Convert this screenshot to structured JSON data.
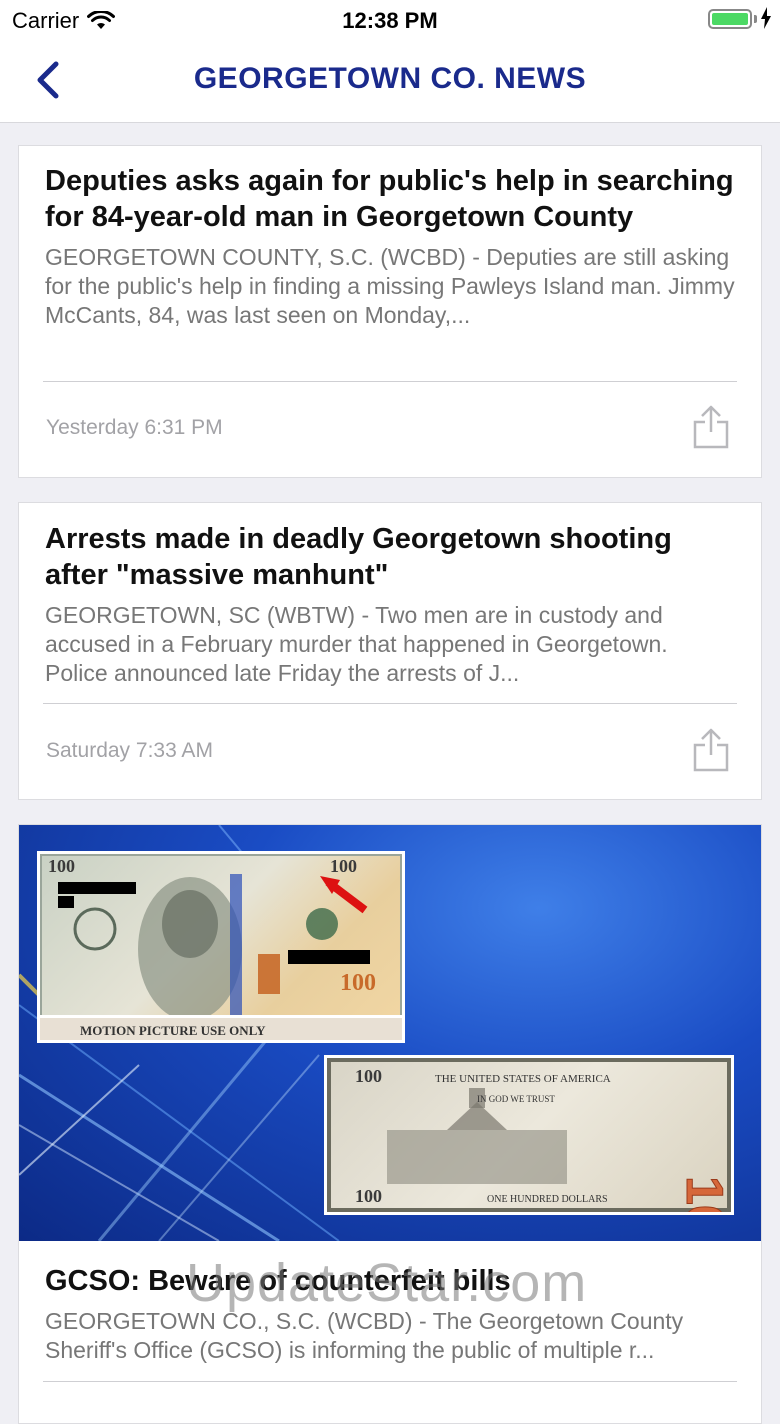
{
  "status_bar": {
    "carrier": "Carrier",
    "time": "12:38 PM",
    "battery_color": "#4cd964"
  },
  "nav": {
    "title": "GEORGETOWN CO. NEWS",
    "back_icon": "chevron-left-icon",
    "title_color": "#1a2a8c"
  },
  "articles": [
    {
      "title": "Deputies asks again for public's help in searching for 84-year-old man in Georgetown County",
      "summary": "GEORGETOWN COUNTY, S.C. (WCBD) - Deputies are still asking for the public's help in finding a missing Pawleys Island man. Jimmy McCants, 84, was last seen on Monday,...",
      "time": "Yesterday 6:31 PM",
      "share_icon": "share-icon"
    },
    {
      "title": "Arrests made in deadly Georgetown shooting after \"massive manhunt\"",
      "summary": "GEORGETOWN, SC (WBTW) - Two men are in custody and accused in a February murder that happened in Georgetown. Police announced late Friday the arrests of J...",
      "time": "Saturday 7:33 AM",
      "share_icon": "share-icon"
    },
    {
      "image": {
        "front_denomination": "100",
        "back_denomination": "100",
        "front_text": "MOTION PICTURE USE ONLY",
        "back_header": "THE UNITED STATES OF AMERICA",
        "back_motto": "IN GOD WE TRUST",
        "back_footer": "ONE HUNDRED DOLLARS"
      },
      "title": "GCSO: Beware of counterfeit bills",
      "summary": "GEORGETOWN CO., S.C. (WCBD) - The Georgetown County Sheriff's Office (GCSO) is informing the public of multiple r..."
    }
  ],
  "watermark": "UpdateStar.com"
}
